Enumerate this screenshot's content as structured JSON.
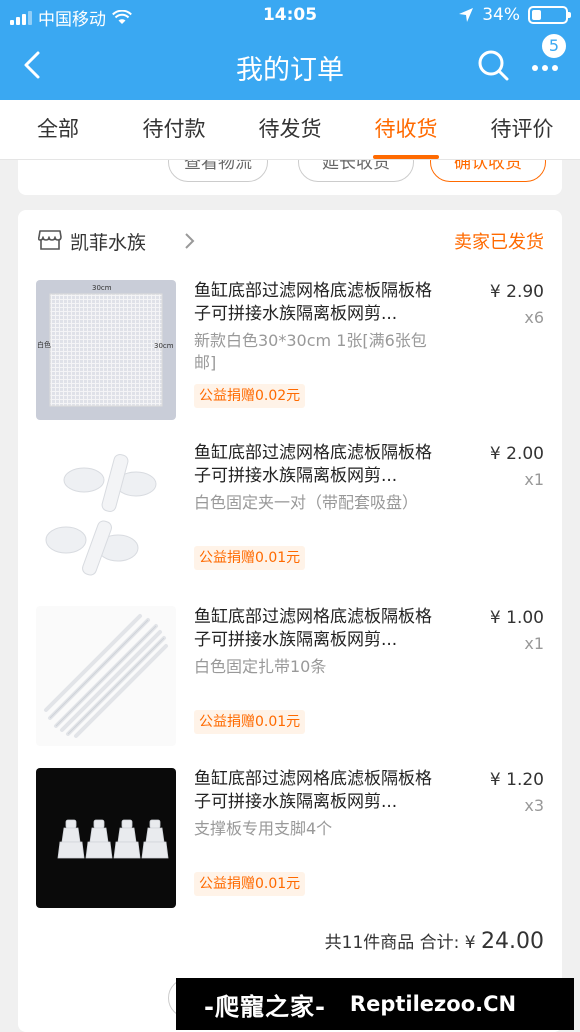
{
  "status_bar": {
    "carrier": "中国移动",
    "time": "14:05",
    "battery": "34%"
  },
  "nav": {
    "title": "我的订单",
    "badge": "5"
  },
  "tabs": [
    {
      "label": "全部"
    },
    {
      "label": "待付款"
    },
    {
      "label": "待发货"
    },
    {
      "label": "待收货",
      "active": true
    },
    {
      "label": "待评价"
    }
  ],
  "prev_order_actions": [
    "查看物流",
    "延长收货",
    "确认收货"
  ],
  "order": {
    "shop_name": "凯菲水族",
    "status": "卖家已发货",
    "items": [
      {
        "title": "鱼缸底部过滤网格底滤板隔板格子可拼接水族隔离板网剪...",
        "spec": "新款白色30*30cm 1张[满6张包邮]",
        "charity": "公益捐赠0.02元",
        "price": "¥ 2.90",
        "qty": "x6",
        "thumb_labels": {
          "top": "30cm",
          "left": "白色",
          "right": "30cm"
        }
      },
      {
        "title": "鱼缸底部过滤网格底滤板隔板格子可拼接水族隔离板网剪...",
        "spec": "白色固定夹一对（带配套吸盘）",
        "charity": "公益捐赠0.01元",
        "price": "¥ 2.00",
        "qty": "x1"
      },
      {
        "title": "鱼缸底部过滤网格底滤板隔板格子可拼接水族隔离板网剪...",
        "spec": "白色固定扎带10条",
        "charity": "公益捐赠0.01元",
        "price": "¥ 1.00",
        "qty": "x1"
      },
      {
        "title": "鱼缸底部过滤网格底滤板隔板格子可拼接水族隔离板网剪...",
        "spec": "支撑板专用支脚4个",
        "charity": "公益捐赠0.01元",
        "price": "¥ 1.20",
        "qty": "x3"
      }
    ],
    "total_label": "共11件商品 合计: ¥ ",
    "total_amount": "24.00"
  },
  "watermark": {
    "cn": "-爬寵之家-",
    "en": "Reptilezoo.CN"
  },
  "colors": {
    "header": "#3aa8f2",
    "accent": "#ff6a00"
  }
}
